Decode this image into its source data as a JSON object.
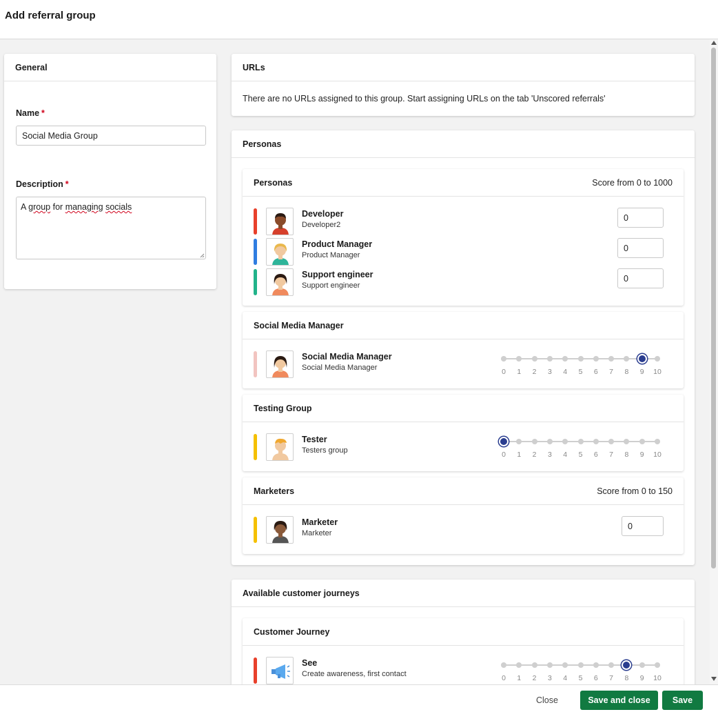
{
  "dialog": {
    "title": "Add referral group"
  },
  "general": {
    "header": "General",
    "name_label": "Name",
    "name_value": "Social Media Group",
    "required_mark": "*",
    "description_label": "Description",
    "description_words": [
      "A",
      "group",
      "for",
      "managing",
      "socials"
    ]
  },
  "urls": {
    "header": "URLs",
    "empty_message": "There are no URLs assigned to this group. Start assigning URLs on the tab 'Unscored referrals'"
  },
  "personas_section": {
    "header": "Personas",
    "groups": [
      {
        "title": "Personas",
        "score_range": "Score from 0 to 1000",
        "members": [
          {
            "name": "Developer",
            "subtitle": "Developer2",
            "score": "0",
            "color": "#e8402b",
            "icon": "developer-avatar-icon"
          },
          {
            "name": "Product Manager",
            "subtitle": "Product Manager",
            "score": "0",
            "color": "#2f7de1",
            "icon": "product-manager-avatar-icon"
          },
          {
            "name": "Support engineer",
            "subtitle": "Support engineer",
            "score": "0",
            "color": "#21b38a",
            "icon": "support-engineer-avatar-icon"
          }
        ]
      },
      {
        "title": "Social Media Manager",
        "members": [
          {
            "name": "Social Media Manager",
            "subtitle": "Social Media Manager",
            "slider_value": 9,
            "color": "#f2c4c0",
            "icon": "social-media-manager-avatar-icon"
          }
        ]
      },
      {
        "title": "Testing Group",
        "members": [
          {
            "name": "Tester",
            "subtitle": "Testers group",
            "slider_value": 0,
            "color": "#f5c000",
            "icon": "tester-avatar-icon"
          }
        ]
      },
      {
        "title": "Marketers",
        "score_range": "Score from 0 to 150",
        "members": [
          {
            "name": "Marketer",
            "subtitle": "Marketer",
            "score": "0",
            "color": "#f5c000",
            "icon": "marketer-avatar-icon"
          }
        ]
      }
    ]
  },
  "journeys": {
    "header": "Available customer journeys",
    "group_title": "Customer Journey",
    "stages": [
      {
        "name": "See",
        "subtitle": "Create awareness, first contact",
        "slider_value": 8,
        "color": "#e8402b",
        "icon": "megaphone-icon"
      }
    ]
  },
  "slider_ticks": [
    "0",
    "1",
    "2",
    "3",
    "4",
    "5",
    "6",
    "7",
    "8",
    "9",
    "10"
  ],
  "footer": {
    "close_label": "Close",
    "save_close_label": "Save and close",
    "save_label": "Save"
  },
  "colors": {
    "primary_button": "#117a41",
    "slider_handle": "#2a3d8f",
    "required": "#d0021b"
  }
}
